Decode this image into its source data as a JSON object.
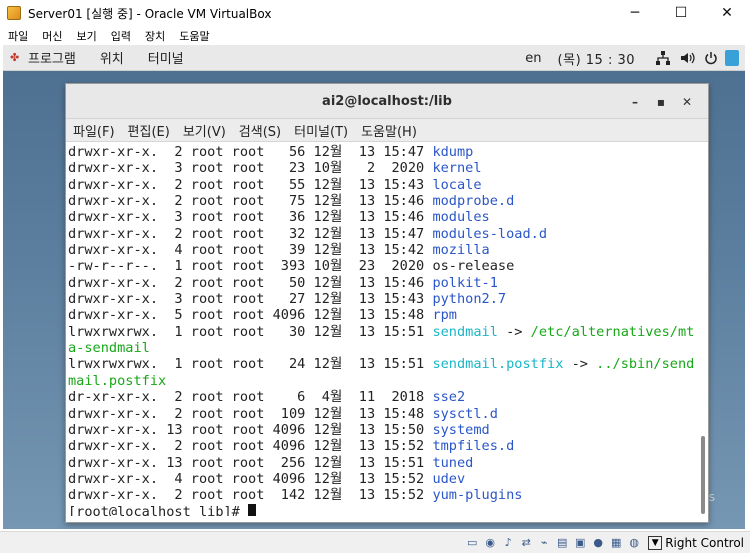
{
  "vbox": {
    "title": "Server01 [실행 중] - Oracle VM VirtualBox",
    "menu": [
      "파일",
      "머신",
      "보기",
      "입력",
      "장치",
      "도움말"
    ],
    "window_buttons": [
      "─",
      "☐",
      "✕"
    ]
  },
  "gnome": {
    "apps": "프로그램",
    "places": "위치",
    "active_app": "터미널",
    "lang": "en",
    "clock": "(목) 15 : 30",
    "tray_icons": [
      "network-icon",
      "volume-icon",
      "power-icon"
    ]
  },
  "terminal": {
    "title": "ai2@localhost:/lib",
    "menu": [
      "파일(F)",
      "편집(E)",
      "보기(V)",
      "검색(S)",
      "터미널(T)",
      "도움말(H)"
    ],
    "lines": [
      {
        "meta": "drwxr-xr-x.  2 root root   56 12월  13 15:47 ",
        "name": "kdump",
        "kind": "dir"
      },
      {
        "meta": "drwxr-xr-x.  3 root root   23 10월   2  2020 ",
        "name": "kernel",
        "kind": "dir"
      },
      {
        "meta": "drwxr-xr-x.  2 root root   55 12월  13 15:43 ",
        "name": "locale",
        "kind": "dir"
      },
      {
        "meta": "drwxr-xr-x.  2 root root   75 12월  13 15:46 ",
        "name": "modprobe.d",
        "kind": "dir"
      },
      {
        "meta": "drwxr-xr-x.  3 root root   36 12월  13 15:46 ",
        "name": "modules",
        "kind": "dir"
      },
      {
        "meta": "drwxr-xr-x.  2 root root   32 12월  13 15:47 ",
        "name": "modules-load.d",
        "kind": "dir"
      },
      {
        "meta": "drwxr-xr-x.  4 root root   39 12월  13 15:42 ",
        "name": "mozilla",
        "kind": "dir"
      },
      {
        "meta": "-rw-r--r--.  1 root root  393 10월  23  2020 ",
        "name": "os-release",
        "kind": "file"
      },
      {
        "meta": "drwxr-xr-x.  2 root root   50 12월  13 15:46 ",
        "name": "polkit-1",
        "kind": "dir"
      },
      {
        "meta": "drwxr-xr-x.  3 root root   27 12월  13 15:43 ",
        "name": "python2.7",
        "kind": "dir"
      },
      {
        "meta": "drwxr-xr-x.  5 root root 4096 12월  13 15:48 ",
        "name": "rpm",
        "kind": "dir"
      },
      {
        "meta": "lrwxrwxrwx.  1 root root   30 12월  13 15:51 ",
        "name": "sendmail",
        "kind": "link",
        "arrow": " -> ",
        "target": "/etc/alternatives/mt"
      },
      {
        "meta": "",
        "name": "",
        "kind": "wrap",
        "target": "a-sendmail"
      },
      {
        "meta": "lrwxrwxrwx.  1 root root   24 12월  13 15:51 ",
        "name": "sendmail.postfix",
        "kind": "link",
        "arrow": " -> ",
        "target": "../sbin/send"
      },
      {
        "meta": "",
        "name": "",
        "kind": "wrap",
        "target": "mail.postfix"
      },
      {
        "meta": "dr-xr-xr-x.  2 root root    6  4월  11  2018 ",
        "name": "sse2",
        "kind": "dir"
      },
      {
        "meta": "drwxr-xr-x.  2 root root  109 12월  13 15:48 ",
        "name": "sysctl.d",
        "kind": "dir"
      },
      {
        "meta": "drwxr-xr-x. 13 root root 4096 12월  13 15:50 ",
        "name": "systemd",
        "kind": "dir"
      },
      {
        "meta": "drwxr-xr-x.  2 root root 4096 12월  13 15:52 ",
        "name": "tmpfiles.d",
        "kind": "dir"
      },
      {
        "meta": "drwxr-xr-x. 13 root root  256 12월  13 15:51 ",
        "name": "tuned",
        "kind": "dir"
      },
      {
        "meta": "drwxr-xr-x.  4 root root 4096 12월  13 15:52 ",
        "name": "udev",
        "kind": "dir"
      },
      {
        "meta": "drwxr-xr-x.  2 root root  142 12월  13 15:52 ",
        "name": "yum-plugins",
        "kind": "dir"
      }
    ],
    "prompt": "[root@localhost lib]# "
  },
  "statusbar": {
    "icons": [
      "hdd-icon",
      "optical-icon",
      "audio-icon",
      "network-icon",
      "usb-icon",
      "shared-folder-icon",
      "display-icon",
      "recording-icon",
      "cpu-icon",
      "mouse-icon"
    ],
    "host_key": "Right Control"
  },
  "colors": {
    "directory": "#2a56c8",
    "symlink": "#1ab6c8",
    "link_target": "#18a818"
  }
}
